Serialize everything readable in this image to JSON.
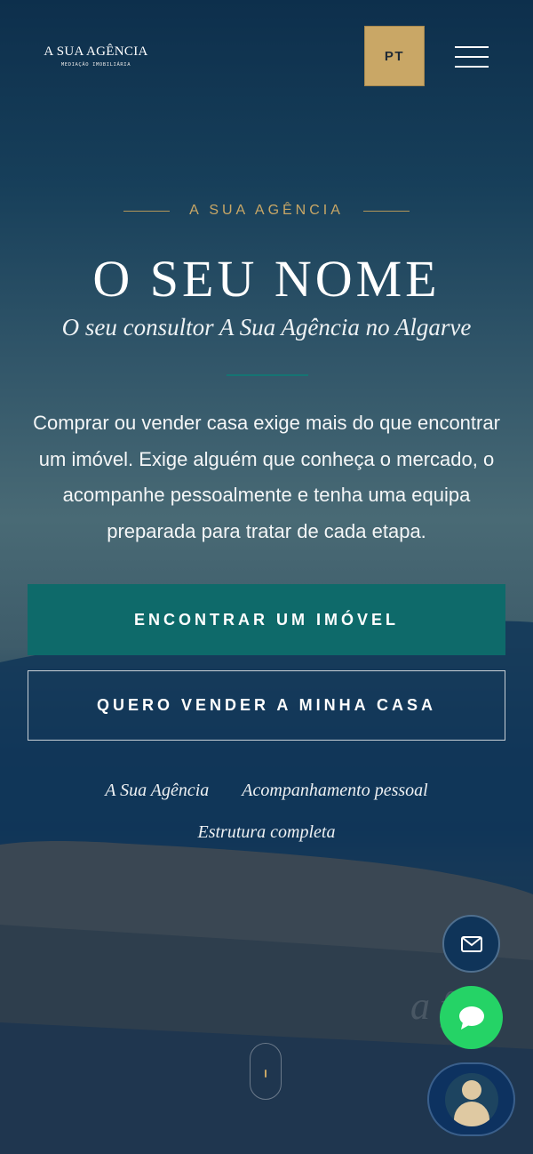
{
  "header": {
    "logo_name": "A SUA AGÊNCIA",
    "logo_subtitle": "MEDIAÇÃO IMOBILIÁRIA",
    "language_label": "PT",
    "menu_icon": "hamburger-menu-icon"
  },
  "hero": {
    "eyebrow": "A SUA AGÊNCIA",
    "title": "O SEU NOME",
    "subtitle": "O seu consultor A Sua Agência no Algarve",
    "description": "Comprar ou vender casa exige mais do que encontrar um imóvel. Exige alguém que conheça o mercado, o acompanhe pessoalmente e tenha uma equipa preparada para tratar de cada etapa.",
    "primary_button": "ENCONTRAR UM IMÓVEL",
    "secondary_button": "QUERO VENDER A MINHA CASA",
    "tags": [
      "A Sua Agência",
      "Acompanhamento pessoal",
      "Estrutura completa"
    ],
    "watermark": "a   f"
  },
  "floating_actions": {
    "mail_icon": "mail-icon",
    "chat_icon": "chat-bubble-icon",
    "avatar_icon": "consultant-avatar-icon"
  },
  "colors": {
    "gold": "#c9a766",
    "teal": "#0e6a6a",
    "navy": "#0f3459",
    "whatsapp_green": "#25d366"
  }
}
